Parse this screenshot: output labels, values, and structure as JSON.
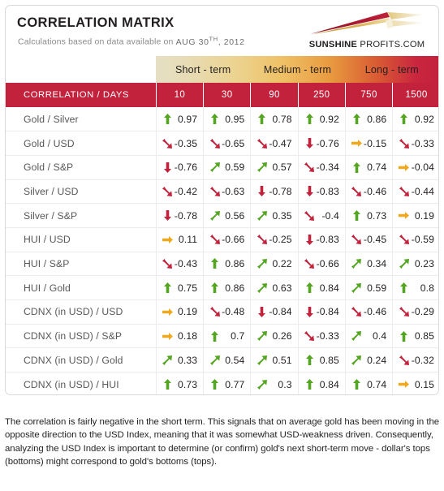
{
  "header": {
    "title": "CORRELATION MATRIX",
    "subtitle_prefix": "Calculations based on data available on",
    "date_main": "AUG 30",
    "date_sup": "TH",
    "date_year": ", 2012"
  },
  "logo": {
    "brand_bold": "SUNSHINE",
    "brand_rest": " PROFITS.COM"
  },
  "term_bands": [
    {
      "label": "Short - term"
    },
    {
      "label": "Medium - term"
    },
    {
      "label": "Long - term"
    }
  ],
  "table": {
    "label_header": "CORRELATION / DAYS",
    "columns": [
      "10",
      "30",
      "90",
      "250",
      "750",
      "1500"
    ],
    "rows": [
      {
        "label": "Gold / Silver",
        "cells": [
          {
            "value": "0.97",
            "arrow": "up"
          },
          {
            "value": "0.95",
            "arrow": "up"
          },
          {
            "value": "0.78",
            "arrow": "up"
          },
          {
            "value": "0.92",
            "arrow": "up"
          },
          {
            "value": "0.86",
            "arrow": "up"
          },
          {
            "value": "0.92",
            "arrow": "up"
          }
        ]
      },
      {
        "label": "Gold / USD",
        "cells": [
          {
            "value": "-0.35",
            "arrow": "down-right"
          },
          {
            "value": "-0.65",
            "arrow": "down-right"
          },
          {
            "value": "-0.47",
            "arrow": "down-right"
          },
          {
            "value": "-0.76",
            "arrow": "down"
          },
          {
            "value": "-0.15",
            "arrow": "right"
          },
          {
            "value": "-0.33",
            "arrow": "down-right"
          }
        ]
      },
      {
        "label": "Gold / S&P",
        "cells": [
          {
            "value": "-0.76",
            "arrow": "down"
          },
          {
            "value": "0.59",
            "arrow": "up-right"
          },
          {
            "value": "0.57",
            "arrow": "up-right"
          },
          {
            "value": "-0.34",
            "arrow": "down-right"
          },
          {
            "value": "0.74",
            "arrow": "up"
          },
          {
            "value": "-0.04",
            "arrow": "right"
          }
        ]
      },
      {
        "label": "Silver / USD",
        "cells": [
          {
            "value": "-0.42",
            "arrow": "down-right"
          },
          {
            "value": "-0.63",
            "arrow": "down-right"
          },
          {
            "value": "-0.78",
            "arrow": "down"
          },
          {
            "value": "-0.83",
            "arrow": "down"
          },
          {
            "value": "-0.46",
            "arrow": "down-right"
          },
          {
            "value": "-0.44",
            "arrow": "down-right"
          }
        ]
      },
      {
        "label": "Silver / S&P",
        "cells": [
          {
            "value": "-0.78",
            "arrow": "down"
          },
          {
            "value": "0.56",
            "arrow": "up-right"
          },
          {
            "value": "0.35",
            "arrow": "up-right"
          },
          {
            "value": "-0.4",
            "arrow": "down-right"
          },
          {
            "value": "0.73",
            "arrow": "up"
          },
          {
            "value": "0.19",
            "arrow": "right"
          }
        ]
      },
      {
        "label": "HUI / USD",
        "cells": [
          {
            "value": "0.11",
            "arrow": "right"
          },
          {
            "value": "-0.66",
            "arrow": "down-right"
          },
          {
            "value": "-0.25",
            "arrow": "down-right"
          },
          {
            "value": "-0.83",
            "arrow": "down"
          },
          {
            "value": "-0.45",
            "arrow": "down-right"
          },
          {
            "value": "-0.59",
            "arrow": "down-right"
          }
        ]
      },
      {
        "label": "HUI / S&P",
        "cells": [
          {
            "value": "-0.43",
            "arrow": "down-right"
          },
          {
            "value": "0.86",
            "arrow": "up"
          },
          {
            "value": "0.22",
            "arrow": "up-right"
          },
          {
            "value": "-0.66",
            "arrow": "down-right"
          },
          {
            "value": "0.34",
            "arrow": "up-right"
          },
          {
            "value": "0.23",
            "arrow": "up-right"
          }
        ]
      },
      {
        "label": "HUI / Gold",
        "cells": [
          {
            "value": "0.75",
            "arrow": "up"
          },
          {
            "value": "0.86",
            "arrow": "up"
          },
          {
            "value": "0.63",
            "arrow": "up-right"
          },
          {
            "value": "0.84",
            "arrow": "up"
          },
          {
            "value": "0.59",
            "arrow": "up-right"
          },
          {
            "value": "0.8",
            "arrow": "up"
          }
        ]
      },
      {
        "label": "CDNX (in USD) / USD",
        "cells": [
          {
            "value": "0.19",
            "arrow": "right"
          },
          {
            "value": "-0.48",
            "arrow": "down-right"
          },
          {
            "value": "-0.84",
            "arrow": "down"
          },
          {
            "value": "-0.84",
            "arrow": "down"
          },
          {
            "value": "-0.46",
            "arrow": "down-right"
          },
          {
            "value": "-0.29",
            "arrow": "down-right"
          }
        ]
      },
      {
        "label": "CDNX (in USD) / S&P",
        "cells": [
          {
            "value": "0.18",
            "arrow": "right"
          },
          {
            "value": "0.7",
            "arrow": "up"
          },
          {
            "value": "0.26",
            "arrow": "up-right"
          },
          {
            "value": "-0.33",
            "arrow": "down-right"
          },
          {
            "value": "0.4",
            "arrow": "up-right"
          },
          {
            "value": "0.85",
            "arrow": "up"
          }
        ]
      },
      {
        "label": "CDNX (in USD) / Gold",
        "cells": [
          {
            "value": "0.33",
            "arrow": "up-right"
          },
          {
            "value": "0.54",
            "arrow": "up-right"
          },
          {
            "value": "0.51",
            "arrow": "up-right"
          },
          {
            "value": "0.85",
            "arrow": "up"
          },
          {
            "value": "0.24",
            "arrow": "up-right"
          },
          {
            "value": "-0.32",
            "arrow": "down-right"
          }
        ]
      },
      {
        "label": "CDNX (in USD) / HUI",
        "cells": [
          {
            "value": "0.73",
            "arrow": "up"
          },
          {
            "value": "0.77",
            "arrow": "up"
          },
          {
            "value": "0.3",
            "arrow": "up-right"
          },
          {
            "value": "0.84",
            "arrow": "up"
          },
          {
            "value": "0.74",
            "arrow": "up"
          },
          {
            "value": "0.15",
            "arrow": "right"
          }
        ]
      }
    ]
  },
  "commentary": "The correlation is fairly negative in the short term. This signals that on average gold has been moving in the opposite direction to the USD Index, meaning that it was somewhat USD-weakness driven. Consequently, analyzing the USD Index is important to determine (or confirm) gold's next short-term move - dollar's tops (bottoms) might correspond to gold's bottoms (tops).",
  "colors": {
    "header_red": "#c3223c",
    "arrow_green": "#54a521",
    "arrow_red": "#c3223c",
    "arrow_orange": "#f0a81e",
    "text_dark": "#231f20",
    "row_label": "#58585a"
  }
}
